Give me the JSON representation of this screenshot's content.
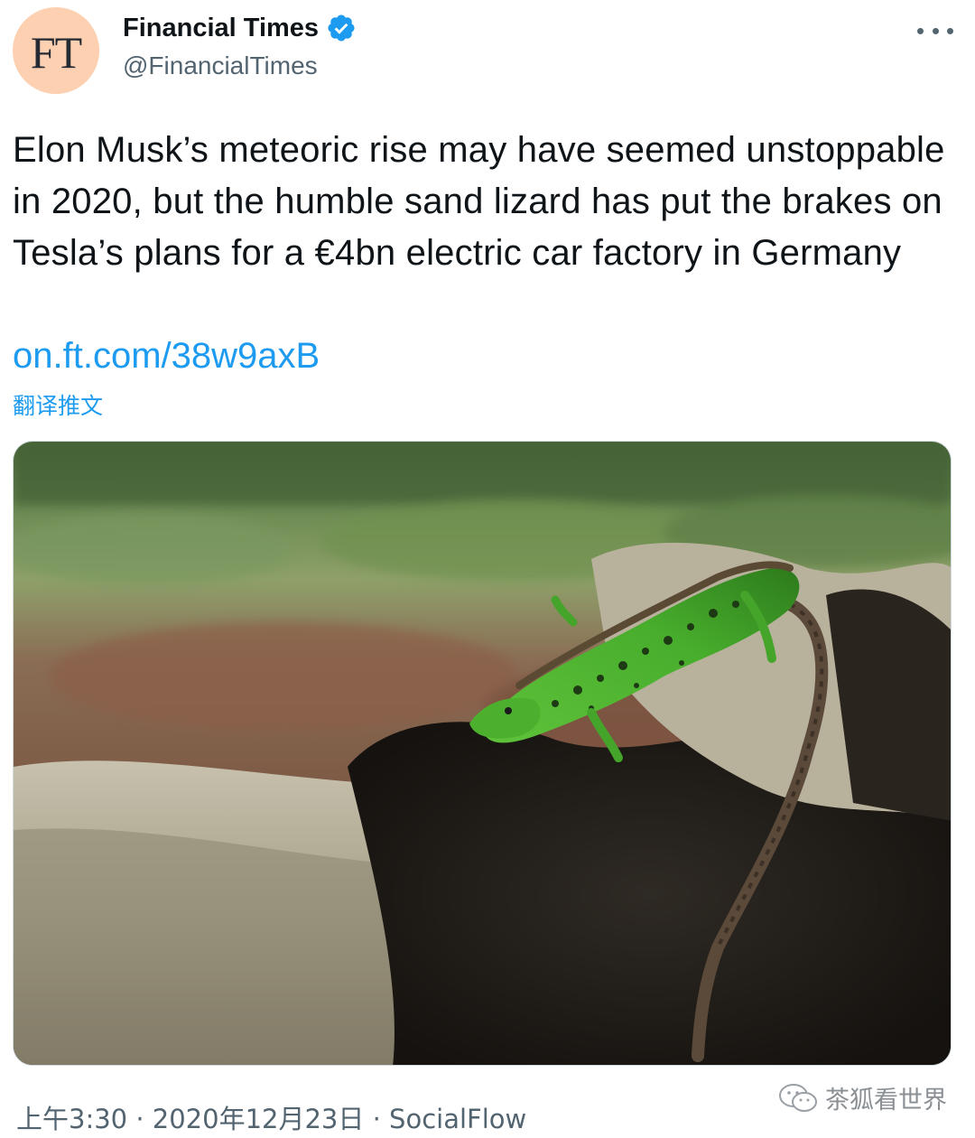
{
  "author": {
    "avatar_text": "FT",
    "name": "Financial Times",
    "handle": "@FinancialTimes",
    "verified": true
  },
  "tweet": {
    "text": "Elon Musk’s meteoric rise may have seemed unstoppable in 2020, but the humble sand lizard has put the brakes on Tesla’s plans for a €4bn electric car factory in Germany",
    "link": "on.ft.com/38w9axB",
    "translate_label": "翻译推文"
  },
  "media": {
    "subject": "green sand lizard on a weathered log"
  },
  "meta": {
    "time": "上午3:30",
    "date": "2020年12月23日",
    "separator": " · ",
    "source": "SocialFlow"
  },
  "watermark": {
    "text": "茶狐看世界"
  },
  "colors": {
    "link": "#1d9bf0",
    "secondary_text": "#536471",
    "verified": "#1d9bf0",
    "avatar_bg": "#fcd0b1"
  },
  "icons": {
    "verified": "verified-badge-icon",
    "more": "more-options-icon",
    "watermark": "wechat-icon"
  }
}
